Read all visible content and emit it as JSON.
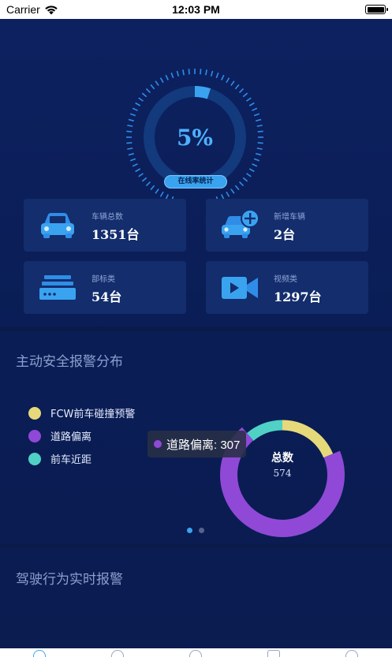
{
  "status_bar": {
    "carrier": "Carrier",
    "time": "12:03 PM"
  },
  "online_gauge": {
    "value_text": "5%",
    "fraction": 0.05,
    "label": "在线率统计"
  },
  "stats": {
    "total_vehicles": {
      "label": "车辆总数",
      "value": "1351台",
      "icon": "car-icon"
    },
    "new_vehicles": {
      "label": "新增车辆",
      "value": "2台",
      "icon": "car-add-icon"
    },
    "device_type": {
      "label": "部标类",
      "value": "54台",
      "icon": "device-icon"
    },
    "video_type": {
      "label": "视频类",
      "value": "1297台",
      "icon": "video-camera-icon"
    }
  },
  "alarm_section": {
    "title": "主动安全报警分布",
    "legend": [
      {
        "name": "FCW前车碰撞预警",
        "color": "#e6d97a"
      },
      {
        "name": "道路偏离",
        "color": "#8f49d6"
      },
      {
        "name": "前车近距",
        "color": "#4fd1c5"
      }
    ],
    "tooltip": "道路偏离: 307",
    "pager_active": 0,
    "pager_count": 2
  },
  "chart_data": {
    "type": "pie",
    "variant": "donut",
    "title": "总数",
    "total": 574,
    "total_text": "574",
    "categories": [
      "FCW前车碰撞预警",
      "道路偏离",
      "前车近距"
    ],
    "values": [
      82,
      307,
      49
    ],
    "colors": [
      "#e6d97a",
      "#8f49d6",
      "#4fd1c5"
    ],
    "legend_position": "left"
  },
  "driving_section": {
    "title": "驾驶行为实时报警"
  }
}
